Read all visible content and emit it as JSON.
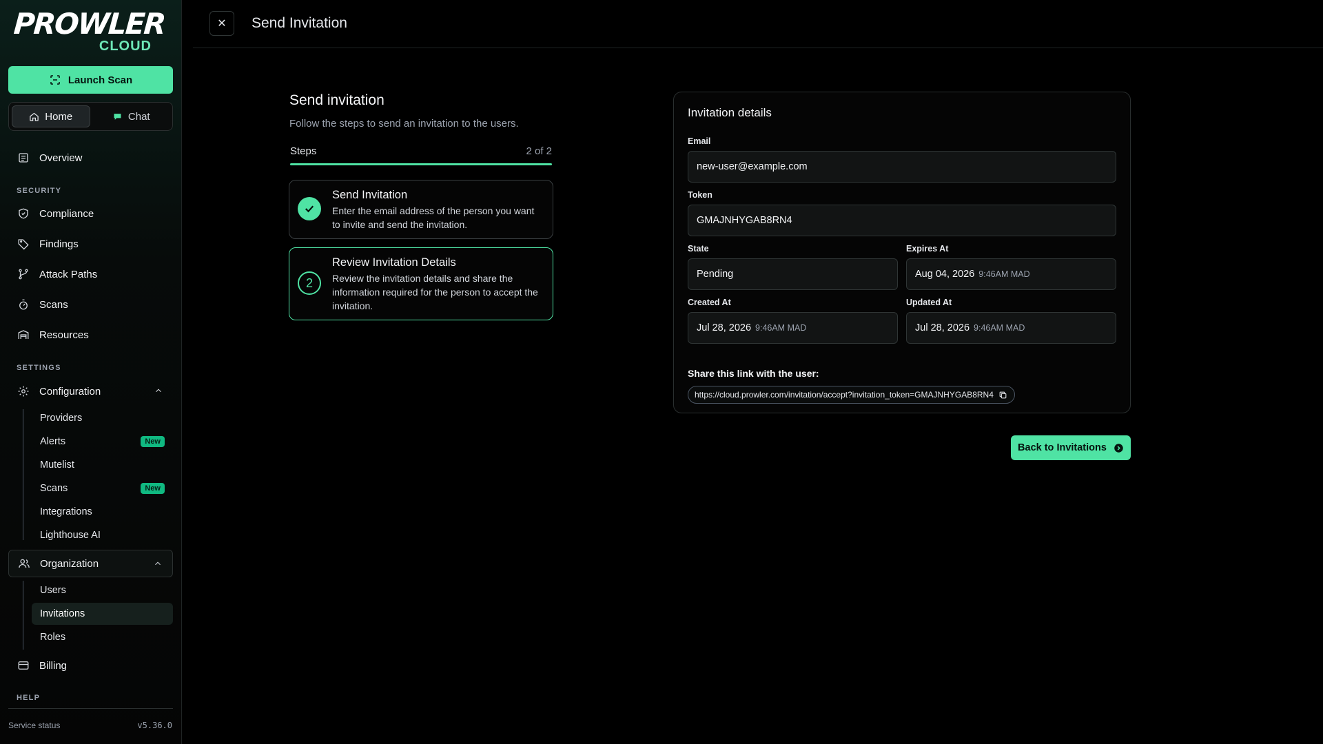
{
  "brand": {
    "name": "PROWLER",
    "suffix": "CLOUD"
  },
  "sidebar": {
    "launch_label": "Launch Scan",
    "segments": [
      {
        "label": "Home",
        "icon": "home-icon"
      },
      {
        "label": "Chat",
        "icon": "chat-icon"
      }
    ],
    "overview": "Overview",
    "security_label": "SECURITY",
    "security_items": [
      "Compliance",
      "Findings",
      "Attack Paths",
      "Scans",
      "Resources"
    ],
    "settings_label": "SETTINGS",
    "configuration": "Configuration",
    "configuration_items": [
      {
        "label": "Providers"
      },
      {
        "label": "Alerts",
        "badge": "New"
      },
      {
        "label": "Mutelist"
      },
      {
        "label": "Scans",
        "badge": "New"
      },
      {
        "label": "Integrations"
      },
      {
        "label": "Lighthouse AI"
      }
    ],
    "organization": "Organization",
    "organization_items": [
      "Users",
      "Invitations",
      "Roles"
    ],
    "billing": "Billing",
    "help_label": "HELP",
    "service_status": "Service status",
    "version": "v5.36.0"
  },
  "topbar": {
    "title": "Send Invitation"
  },
  "steps": {
    "title": "Send invitation",
    "subtitle": "Follow the steps to send an invitation to the users.",
    "bar_label": "Steps",
    "bar_count": "2 of 2",
    "progress": 1.0,
    "items": [
      {
        "title": "Send Invitation",
        "desc": "Enter the email address of the person you want to invite and send the invitation.",
        "state": "done"
      },
      {
        "number": "2",
        "title": "Review Invitation Details",
        "desc": "Review the invitation details and share the information required for the person to accept the invitation.",
        "state": "active"
      }
    ]
  },
  "details": {
    "title": "Invitation details",
    "email_label": "Email",
    "email": "new-user@example.com",
    "token_label": "Token",
    "token": "GMAJNHYGAB8RN4",
    "state_label": "State",
    "state": "Pending",
    "expires_label": "Expires At",
    "expires_date": "Aug 04, 2026",
    "expires_time": "9:46AM MAD",
    "created_label": "Created At",
    "created_date": "Jul 28, 2026",
    "created_time": "9:46AM MAD",
    "updated_label": "Updated At",
    "updated_date": "Jul 28, 2026",
    "updated_time": "9:46AM MAD",
    "share_label": "Share this link with the user:",
    "share_link": "https://cloud.prowler.com/invitation/accept?invitation_token=GMAJNHYGAB8RN4"
  },
  "back_button": "Back to Invitations",
  "colors": {
    "accent": "#4fe3a4",
    "background": "#000000"
  }
}
